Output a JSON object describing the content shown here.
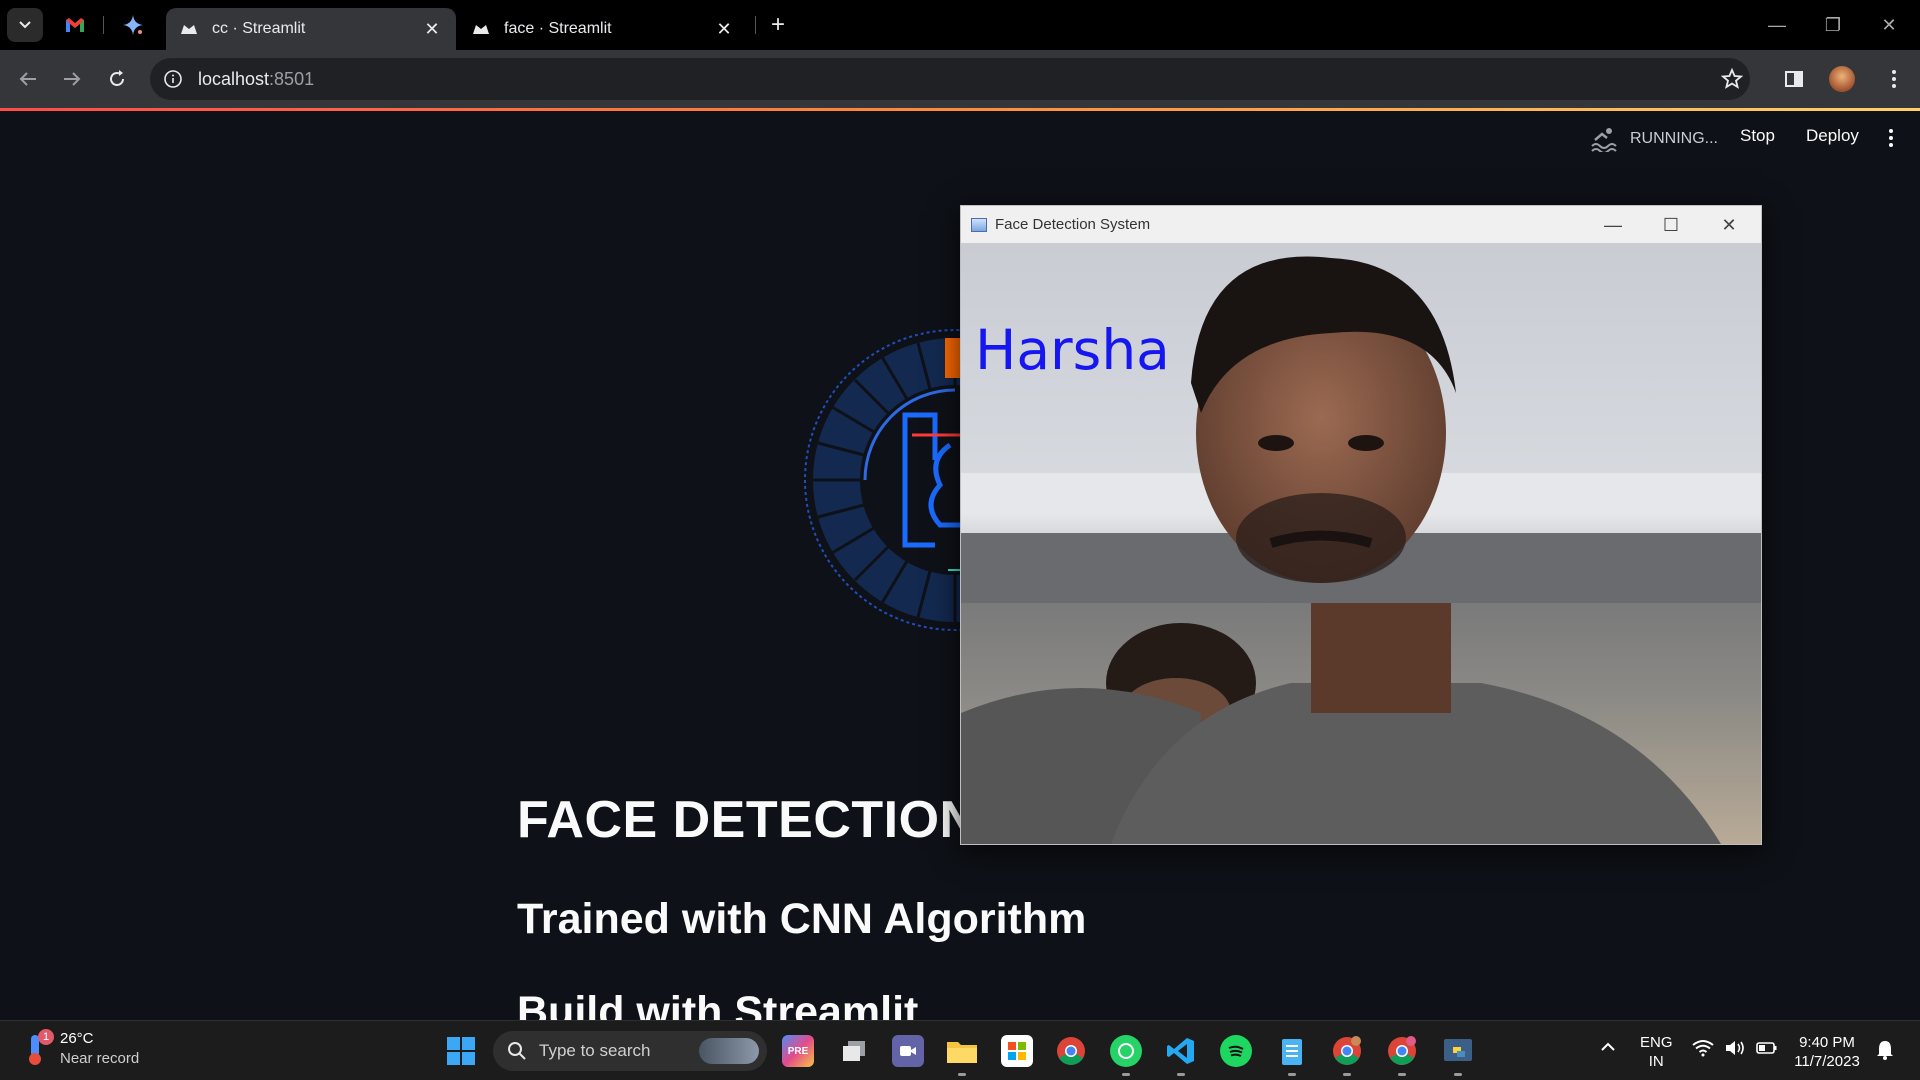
{
  "browser": {
    "tabs": [
      {
        "label": "cc · Streamlit",
        "active": true
      },
      {
        "label": "face · Streamlit",
        "active": false
      }
    ],
    "address": {
      "host": "localhost",
      "port": ":8501"
    }
  },
  "streamlit_header": {
    "status": "RUNNING...",
    "stop_label": "Stop",
    "deploy_label": "Deploy"
  },
  "main": {
    "heading": "FACE DETECTION",
    "subheading": "Trained with CNN Algorithm",
    "subheading2": "Build with Streamlit"
  },
  "face_window": {
    "title": "Face Detection System",
    "detected_name": "Harsha"
  },
  "taskbar": {
    "weather_temp": "26°C",
    "weather_desc": "Near record",
    "weather_badge": "1",
    "search_placeholder": "Type to search",
    "lang_top": "ENG",
    "lang_bottom": "IN",
    "time": "9:40 PM",
    "date": "11/7/2023"
  },
  "colors": {
    "app_bg": "#0e1117",
    "accent_red": "#ff4b4b",
    "label_blue": "#1616f0"
  }
}
